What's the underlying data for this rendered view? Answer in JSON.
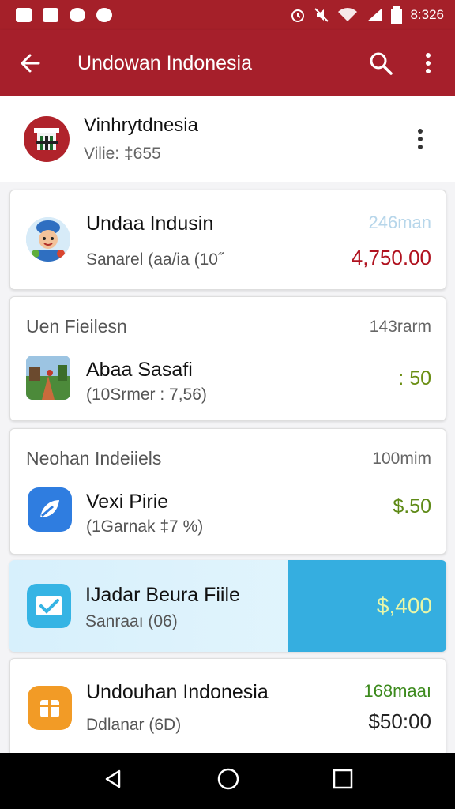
{
  "status_bar": {
    "time": "8:326"
  },
  "app_bar": {
    "title": "Undowan Indonesia"
  },
  "header": {
    "name": "Vinhrytdnesia",
    "sub": "Vilie: ‡655"
  },
  "cards": [
    {
      "title": "",
      "meta": "",
      "name": "Undaa Indusin",
      "sub": "Sanarel (aa/ia (10˝",
      "sub_tail": "",
      "amount": "4,750.00",
      "time": "246man",
      "amount_color": "#b0121f"
    },
    {
      "title": "Uen Fieilesn",
      "meta": "143rarm",
      "name": "Abaa Sasafi",
      "sub": "(10Srmer : 7,56)",
      "amount": ": 50",
      "amount_color": "#6a8e12"
    },
    {
      "title": "Neohan Indeiiels",
      "meta": "100mim",
      "name": "Vexi Pirie",
      "sub": "(1Garnak ‡7 %)",
      "amount": "$.50",
      "amount_color": "#5e8a16"
    },
    {
      "title": "",
      "meta": "",
      "name": "IJadar Beura Fiile",
      "sub": "Sanraaı (06)",
      "amount": "$,400",
      "amount_color": "#e9f7a8"
    },
    {
      "title": "",
      "meta": "168maaı",
      "name": "Undouhan Indonesia",
      "sub": "Ddlanar (6D)",
      "amount": "$50:00",
      "amount_color": "#222222"
    }
  ],
  "colors": {
    "brand": "#a61f2b",
    "highlight": "#35aee0",
    "highlight_light": "#d7f0fc"
  },
  "icons": [
    "gallery-icon",
    "calendar-icon",
    "chat-icon",
    "message-icon",
    "alarm-icon",
    "mute-icon",
    "wifi-icon",
    "signal-icon",
    "battery-icon",
    "back-arrow-icon",
    "search-icon",
    "more-vert-icon",
    "nav-back-icon",
    "nav-home-icon",
    "nav-recent-icon"
  ]
}
